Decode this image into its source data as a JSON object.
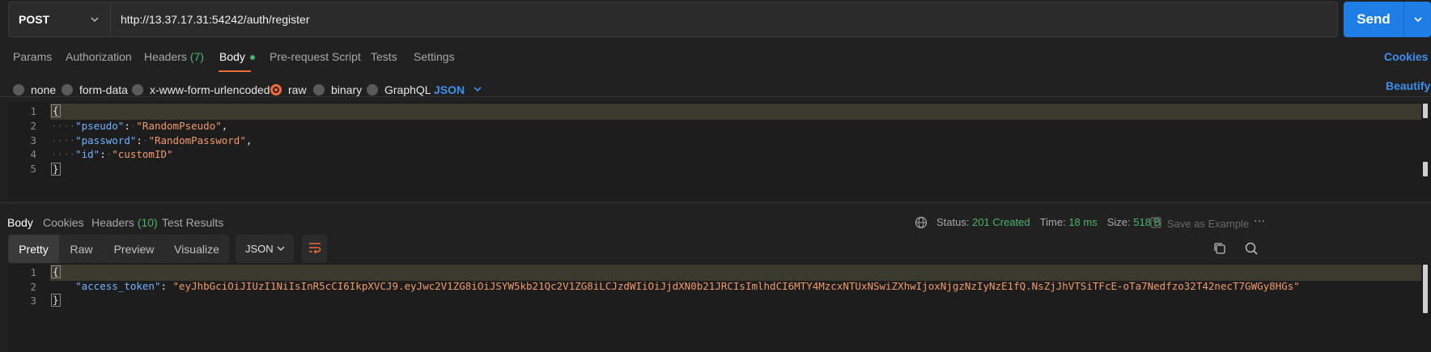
{
  "request": {
    "method": "POST",
    "url": "http://13.37.17.31:54242/auth/register",
    "send_label": "Send"
  },
  "request_tabs": {
    "params": "Params",
    "authorization": "Authorization",
    "headers_label": "Headers",
    "headers_count": "(7)",
    "body": "Body",
    "pre_request": "Pre-request Script",
    "tests": "Tests",
    "settings": "Settings",
    "cookies": "Cookies"
  },
  "body_types": {
    "none": "none",
    "form_data": "form-data",
    "urlencoded": "x-www-form-urlencoded",
    "raw": "raw",
    "binary": "binary",
    "graphql": "GraphQL",
    "format": "JSON",
    "beautify": "Beautify"
  },
  "request_body": {
    "line_numbers": [
      "1",
      "2",
      "3",
      "4",
      "5"
    ],
    "open_brace": "{",
    "close_brace": "}",
    "fields": [
      {
        "key": "\"pseudo\"",
        "value": "\"RandomPseudo\"",
        "trail": ","
      },
      {
        "key": "\"password\"",
        "value": "\"RandomPassword\"",
        "trail": ","
      },
      {
        "key": "\"id\"",
        "value": "\"customID\"",
        "trail": ""
      }
    ]
  },
  "response_tabs": {
    "body": "Body",
    "cookies": "Cookies",
    "headers_label": "Headers",
    "headers_count": "(10)",
    "test_results": "Test Results"
  },
  "response_status": {
    "status_label": "Status:",
    "status_value": "201 Created",
    "time_label": "Time:",
    "time_value": "18 ms",
    "size_label": "Size:",
    "size_value": "518 B",
    "save_example": "Save as Example",
    "more": "···"
  },
  "view_modes": {
    "pretty": "Pretty",
    "raw": "Raw",
    "preview": "Preview",
    "visualize": "Visualize",
    "format": "JSON"
  },
  "response_body": {
    "line_numbers": [
      "1",
      "2",
      "3"
    ],
    "open_brace": "{",
    "close_brace": "}",
    "key": "\"access_token\"",
    "value": "\"eyJhbGciOiJIUzI1NiIsInR5cCI6IkpXVCJ9.eyJwc2V1ZG8iOiJSYW5kb21Qc2V1ZG8iLCJzdWIiOiJjdXN0b21JRCIsImlhdCI6MTY4MzcxNTUxNSwiZXhwIjoxNjgzNzIyNzE1fQ.NsZjJhVTSiTFcE-oTa7Nedfzo32T42necT7GWGy8HGs\""
  },
  "colors": {
    "accent": "#f26b3a",
    "send": "#1f7de6",
    "success": "#49b66a",
    "link": "#3d8ff0"
  }
}
